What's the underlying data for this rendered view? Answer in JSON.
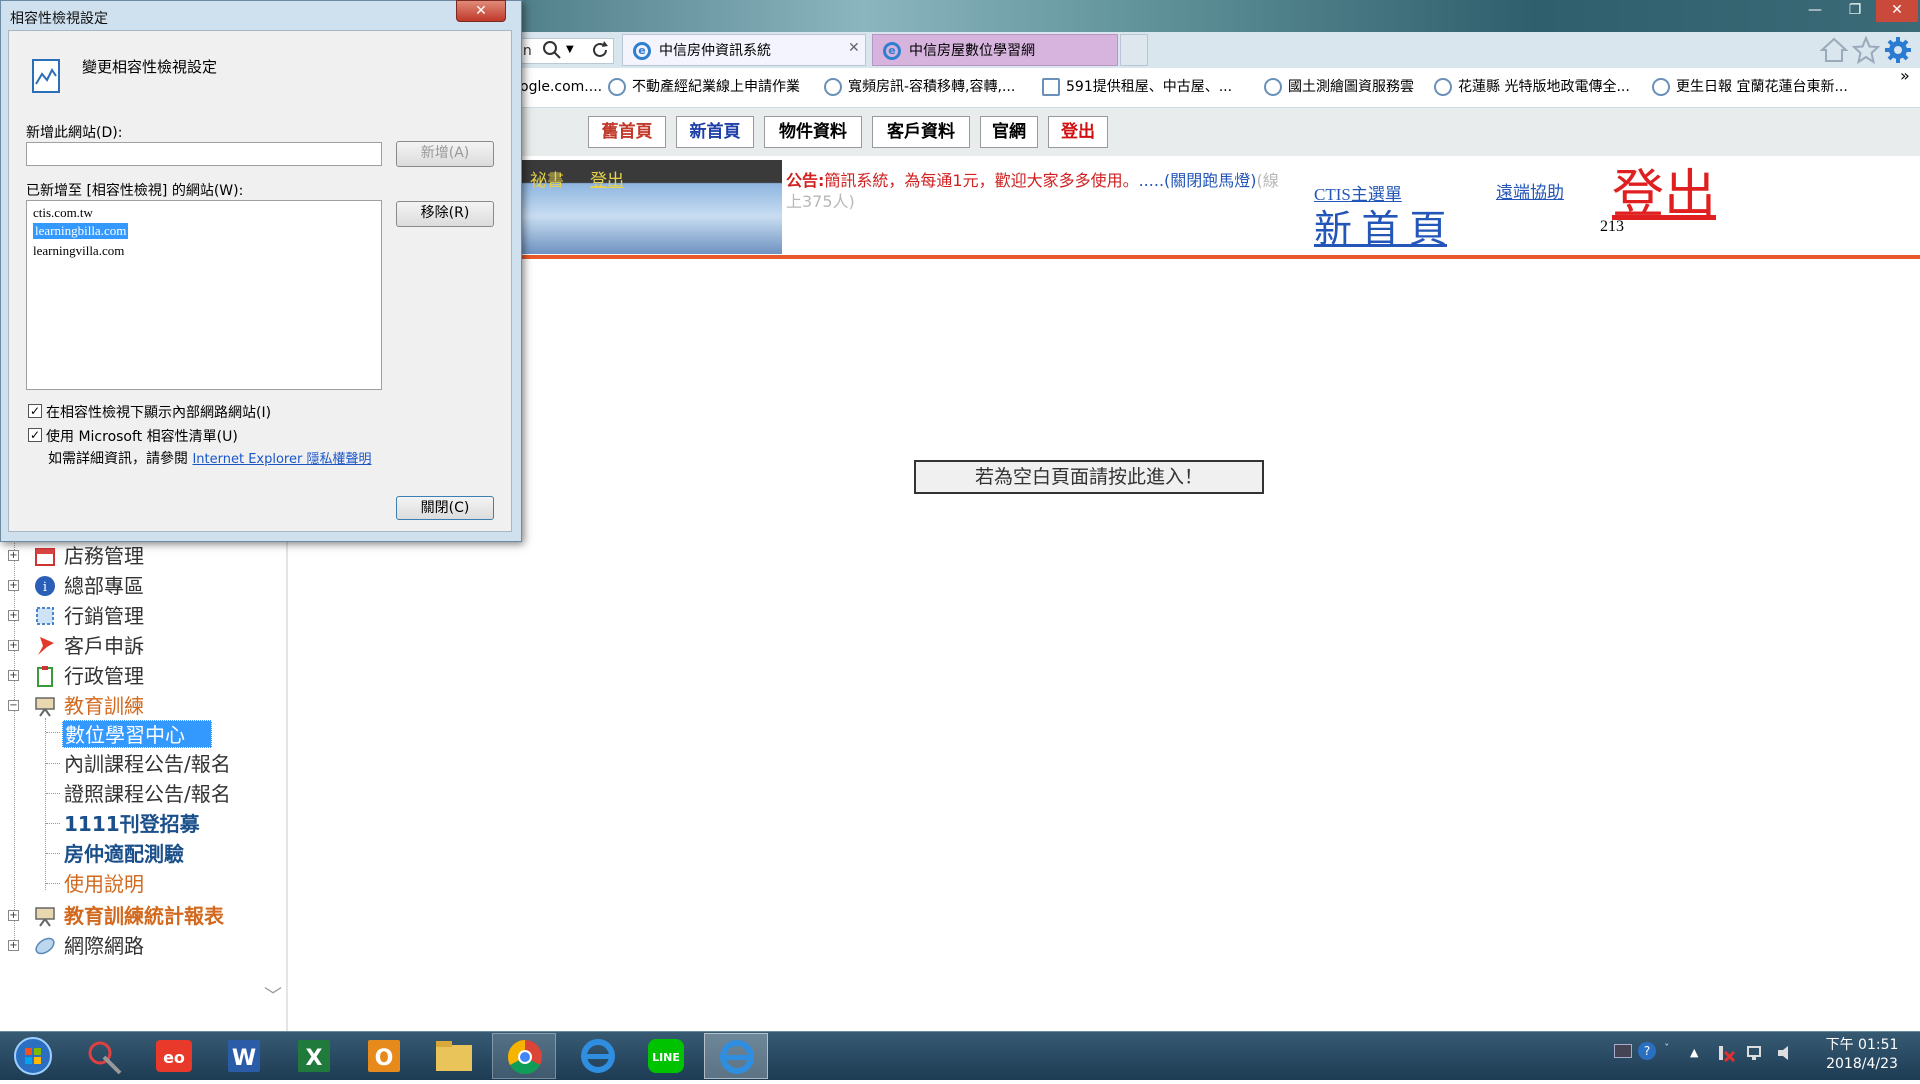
{
  "window": {
    "minimize": "—",
    "restore": "❐",
    "close": "✕"
  },
  "browser": {
    "address_tail": "in",
    "tabs": [
      {
        "label": "中信房仲資訊系統",
        "close": "✕"
      },
      {
        "label": "中信房屋數位學習網"
      }
    ],
    "favorites": [
      {
        "label": "ogle.com...."
      },
      {
        "label": "不動產經紀業線上申請作業"
      },
      {
        "label": "寬頻房訊-容積移轉,容轉,..."
      },
      {
        "label": "591提供租屋、中古屋、..."
      },
      {
        "label": "國土測繪圖資服務雲"
      },
      {
        "label": "花蓮縣 光特版地政電傳全..."
      },
      {
        "label": "更生日報 宜蘭花蓮台東新..."
      }
    ],
    "fav_more": "»"
  },
  "page": {
    "top_buttons": [
      {
        "label": "舊首頁",
        "color": "#c0392b"
      },
      {
        "label": "新首頁",
        "color": "#1f3fa8"
      },
      {
        "label": "物件資料",
        "color": "#333333"
      },
      {
        "label": "客戶資料",
        "color": "#333333"
      },
      {
        "label": "官網",
        "color": "#333333"
      },
      {
        "label": "登出",
        "color": "#d01010"
      }
    ],
    "banner_links": {
      "secretary": "祕書",
      "logout": "登出"
    },
    "announcement_label": "公告:",
    "announcement_text": "簡訊系統，為每通1元，歡迎大家多多使用。",
    "announcement_close": ".....(關閉跑馬燈)",
    "online_count": "(線上375人)",
    "ctis_menu": "CTIS主選單",
    "new_home": "新 首 頁",
    "remote_help": "遠端協助",
    "logout_big": "登出",
    "user_code": "213",
    "blank_page_button": "若為空白頁面請按此進入！"
  },
  "tree": {
    "items": [
      {
        "label": "店務管理",
        "icon": "calendar-icon",
        "expanded": false
      },
      {
        "label": "總部專區",
        "icon": "info-icon",
        "expanded": false
      },
      {
        "label": "行銷管理",
        "icon": "marketing-icon",
        "expanded": false
      },
      {
        "label": "客戶申訴",
        "icon": "pushpin-icon",
        "expanded": false
      },
      {
        "label": "行政管理",
        "icon": "clipboard-icon",
        "expanded": false
      },
      {
        "label": "教育訓練",
        "icon": "presentation-icon",
        "expanded": true
      }
    ],
    "children": [
      {
        "label": "數位學習中心",
        "selected": true
      },
      {
        "label": "內訓課程公告/報名"
      },
      {
        "label": "證照課程公告/報名"
      },
      {
        "label": "1111刊登招募"
      },
      {
        "label": "房仲適配測驗"
      },
      {
        "label": "使用說明"
      }
    ],
    "after": [
      {
        "label": "教育訓練統計報表",
        "icon": "presentation-icon"
      },
      {
        "label": "網際網路",
        "icon": "network-icon"
      }
    ],
    "scroll_arrow": "﹀"
  },
  "dialog": {
    "title": "相容性檢視設定",
    "close": "✕",
    "heading": "變更相容性檢視設定",
    "add_label": "新增此網站(D):",
    "add_value": "",
    "add_button": "新增(A)",
    "list_label": "已新增至 [相容性檢視] 的網站(W):",
    "sites": [
      "ctis.com.tw",
      "learningbilla.com",
      "learningvilla.com"
    ],
    "selected_index": 1,
    "remove_button": "移除(R)",
    "check1": "在相容性檢視下顯示內部網路網站(I)",
    "check2": "使用 Microsoft 相容性清單(U)",
    "info_prefix": "如需詳細資訊，請參閱",
    "info_link": "Internet Explorer 隱私權聲明",
    "close_button": "關閉(C)"
  },
  "taskbar": {
    "apps": [
      "start-orb",
      "snipping-tool",
      "eoffice",
      "word",
      "excel",
      "outlook",
      "file-explorer",
      "chrome",
      "internet-explorer",
      "line",
      "internet-explorer-active"
    ],
    "time": "下午 01:51",
    "date": "2018/4/23"
  },
  "colors": {
    "accent_orange": "#e8592a",
    "tree_orange": "#d2691e",
    "tree_blue": "#1a4f8a",
    "link_blue": "#2356b8"
  }
}
